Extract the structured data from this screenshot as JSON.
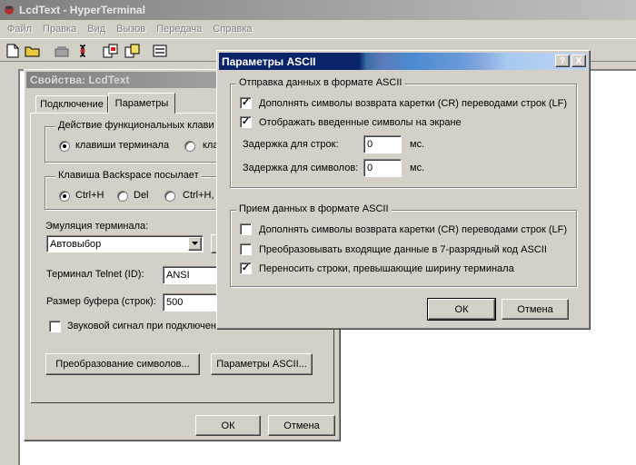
{
  "main_window": {
    "title": "LcdText - HyperTerminal",
    "menu": [
      "Файл",
      "Правка",
      "Вид",
      "Вызов",
      "Передача",
      "Справка"
    ],
    "toolbar_icons": [
      "new-file-icon",
      "open-folder-icon",
      "phone-icon",
      "disconnect-icon",
      "send-icon",
      "receive-icon",
      "properties-icon"
    ]
  },
  "properties_dialog": {
    "title": "Свойства: LcdText",
    "tabs": [
      "Подключение",
      "Параметры"
    ],
    "function_keys": {
      "title": "Действие функциональных клави",
      "options": [
        "клавиши терминала",
        "кла"
      ],
      "selected": 0
    },
    "backspace": {
      "title": "Клавиша  Backspace посылает",
      "options": [
        "Ctrl+H",
        "Del",
        "Ctrl+H, П"
      ],
      "selected": 0
    },
    "emulation_label": "Эмуляция терминала:",
    "emulation_value": "Автовыбор",
    "telnet_label": "Терминал Telnet (ID):",
    "telnet_value": "ANSI",
    "buffer_label": "Размер буфера (строк):",
    "buffer_value": "500",
    "sound_label": "Звуковой сигнал при подключени",
    "char_conversion_button": "Преобразование символов...",
    "ascii_params_button": "Параметры ASCII...",
    "ok": "ОК",
    "cancel": "Отмена"
  },
  "ascii_dialog": {
    "title": "Параметры ASCII",
    "help_button": "?",
    "close_button": "X",
    "send_group": {
      "title": "Отправка данных в формате ASCII",
      "append_lf": "Дополнять символы возврата каретки (CR) переводами строк (LF)",
      "append_lf_checked": true,
      "echo": "Отображать введенные символы на экране",
      "echo_checked": true,
      "line_delay_label": "Задержка для строк:",
      "line_delay_value": "0",
      "char_delay_label": "Задержка для символов:",
      "char_delay_value": "0",
      "unit": "мс."
    },
    "receive_group": {
      "title": "Прием данных в формате ASCII",
      "append_lf": "Дополнять символы возврата каретки (CR) переводами строк (LF)",
      "append_lf_checked": false,
      "force_7bit": "Преобразовывать входящие данные в 7-разрядный код ASCII",
      "force_7bit_checked": false,
      "wrap": "Переносить строки, превышающие ширину терминала",
      "wrap_checked": true
    },
    "ok": "ОК",
    "cancel": "Отмена"
  }
}
